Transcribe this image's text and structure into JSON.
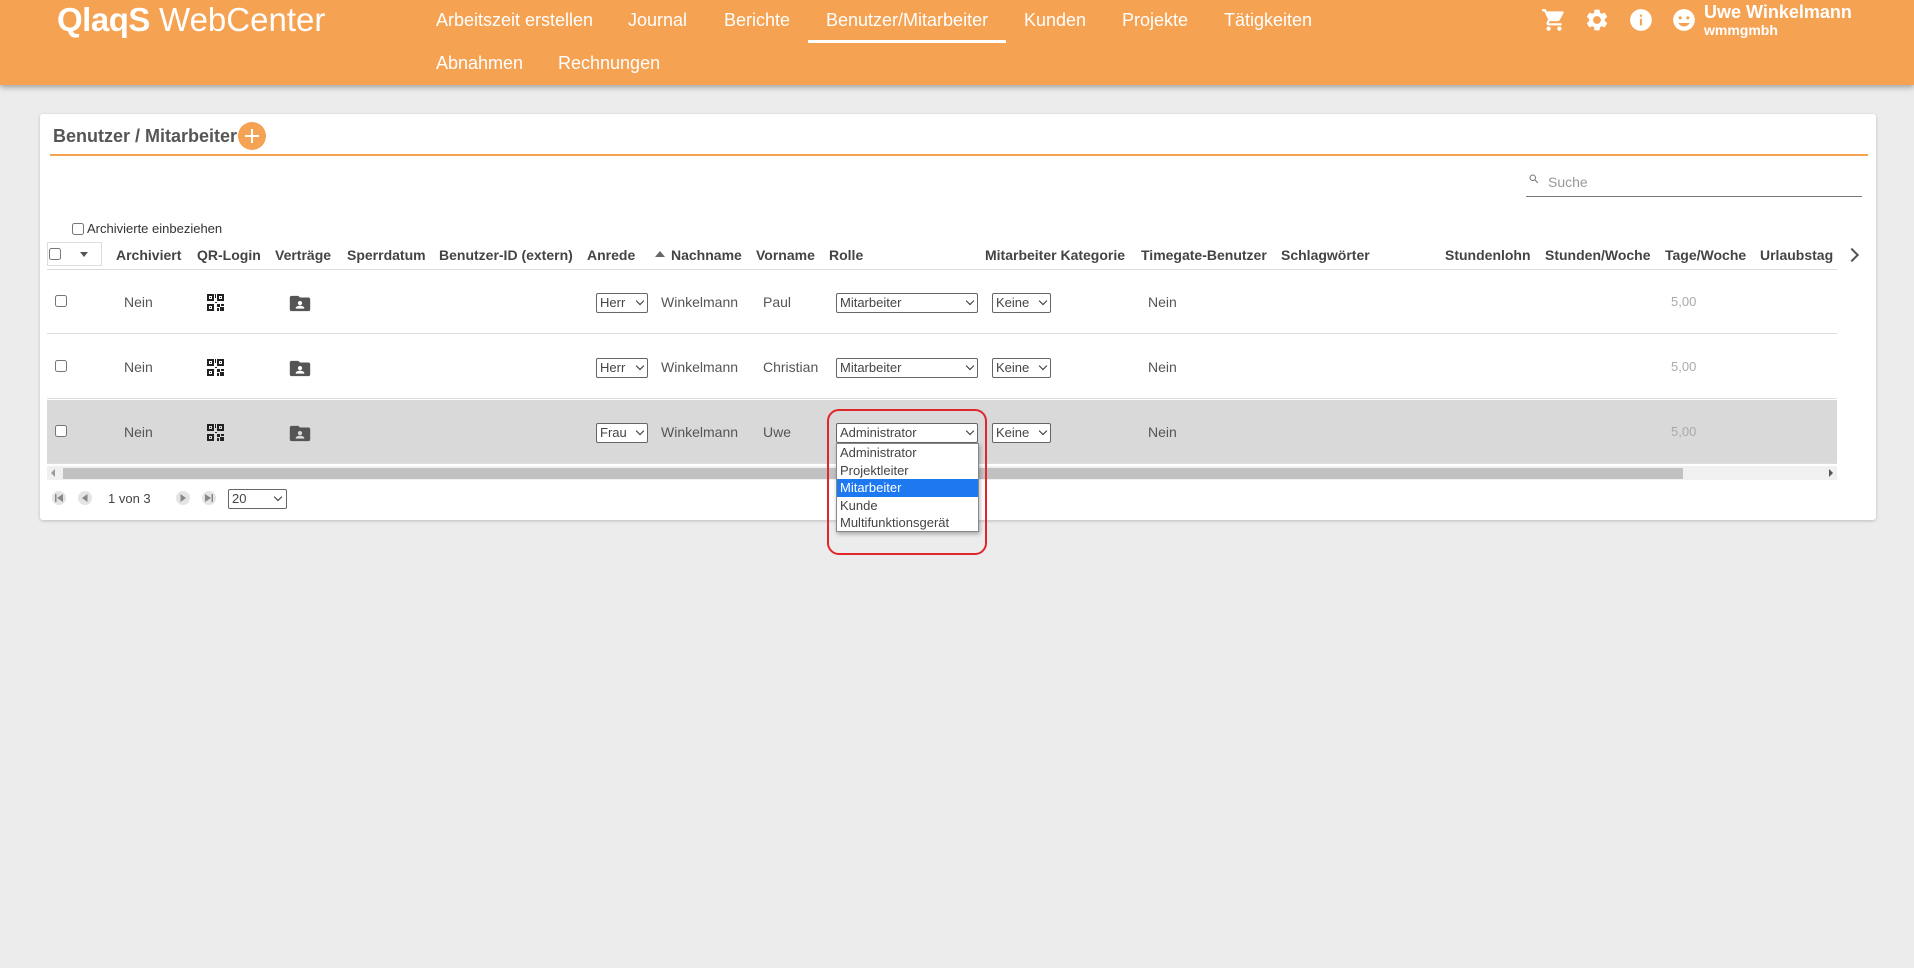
{
  "app": {
    "logo_brand": "QlaqS",
    "logo_product": "WebCenter"
  },
  "nav": {
    "items": [
      {
        "label": "Arbeitszeit erstellen"
      },
      {
        "label": "Journal"
      },
      {
        "label": "Berichte"
      },
      {
        "label": "Benutzer/Mitarbeiter",
        "active": true
      },
      {
        "label": "Kunden"
      },
      {
        "label": "Projekte"
      },
      {
        "label": "Tätigkeiten"
      },
      {
        "label": "Abnahmen"
      },
      {
        "label": "Rechnungen"
      }
    ]
  },
  "header_icons": [
    "cart-icon",
    "settings-gear-icon",
    "info-icon",
    "user-avatar-icon"
  ],
  "user": {
    "name": "Uwe Winkelmann",
    "company": "wmmgmbh"
  },
  "page": {
    "title": "Benutzer / Mitarbeiter",
    "search_placeholder": "Suche",
    "archived_label": "Archivierte einbeziehen"
  },
  "table": {
    "columns": {
      "archiviert": "Archiviert",
      "qr_login": "QR-Login",
      "vertraege": "Verträge",
      "sperrdatum": "Sperrdatum",
      "benutzer_id": "Benutzer-ID (extern)",
      "anrede": "Anrede",
      "nachname": "Nachname",
      "vorname": "Vorname",
      "rolle": "Rolle",
      "kategorie": "Mitarbeiter Kategorie",
      "timegate": "Timegate-Benutzer",
      "schlagwoerter": "Schlagwörter",
      "stundenlohn": "Stundenlohn",
      "stunden_woche": "Stunden/Woche",
      "tage_woche": "Tage/Woche",
      "urlaubstag": "Urlaubstag"
    },
    "sort_column": "Nachname",
    "sort_direction": "ascending",
    "rows": [
      {
        "archiviert": "Nein",
        "anrede": "Herr",
        "nachname": "Winkelmann",
        "vorname": "Paul",
        "rolle": "Mitarbeiter",
        "kategorie": "Keine",
        "timegate": "Nein",
        "tage_woche": "5,00",
        "selected": false
      },
      {
        "archiviert": "Nein",
        "anrede": "Herr",
        "nachname": "Winkelmann",
        "vorname": "Christian",
        "rolle": "Mitarbeiter",
        "kategorie": "Keine",
        "timegate": "Nein",
        "tage_woche": "5,00",
        "selected": false
      },
      {
        "archiviert": "Nein",
        "anrede": "Frau",
        "nachname": "Winkelmann",
        "vorname": "Uwe",
        "rolle": "Administrator",
        "kategorie": "Keine",
        "timegate": "Nein",
        "tage_woche": "5,00",
        "selected": true
      }
    ]
  },
  "pager": {
    "text": "1 von 3",
    "page_size": "20"
  },
  "role_dropdown": {
    "options": [
      "Administrator",
      "Projektleiter",
      "Mitarbeiter",
      "Kunde",
      "Multifunktionsgerät"
    ],
    "highlighted": "Mitarbeiter"
  },
  "colors": {
    "accent": "#f5a253",
    "highlight": "#1e78f0",
    "callout": "#e0262b",
    "background": "#ececec"
  }
}
